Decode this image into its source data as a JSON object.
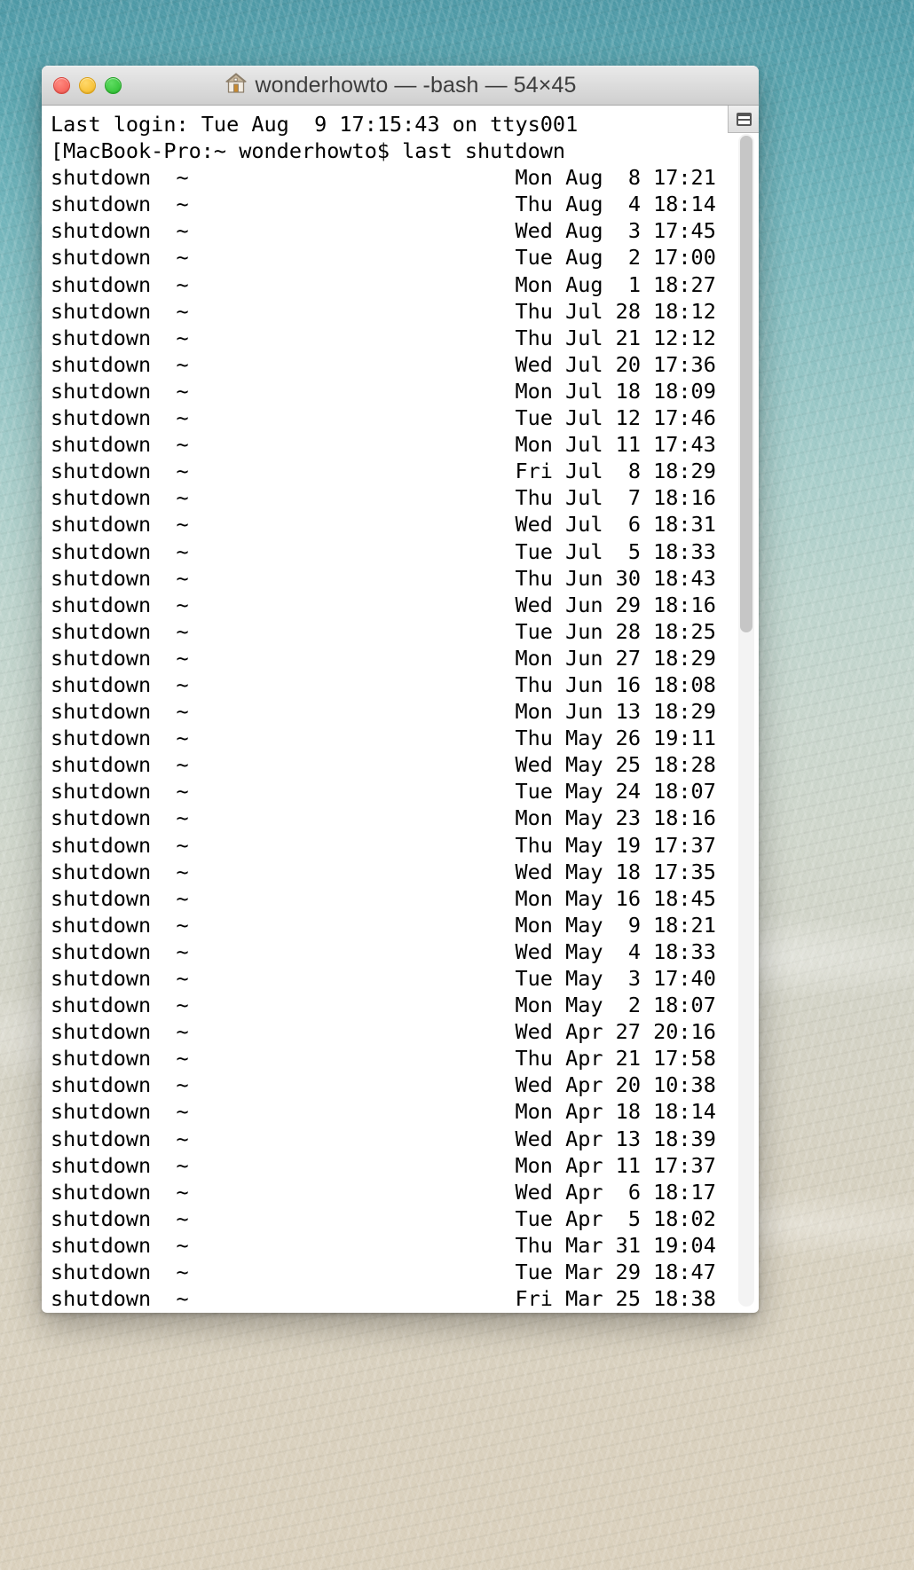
{
  "window": {
    "title": "wonderhowto — -bash — 54×45",
    "title_icon": "house-icon",
    "close_label": "",
    "minimize_label": "",
    "zoom_label": "",
    "split_pane_icon": "split-pane-icon",
    "dimensions_label": "54×45"
  },
  "terminal": {
    "login_line": "Last login: Tue Aug  9 17:15:43 on ttys001",
    "prompt_line": "[MacBook-Pro:~ wonderhowto$ last shutdown",
    "prompt_host": "MacBook-Pro",
    "prompt_cwd": "~",
    "prompt_user": "wonderhowto",
    "command": "last shutdown",
    "col_process": "shutdown",
    "col_tty": "~",
    "entries": [
      {
        "process": "shutdown",
        "tty": "~",
        "day": "Mon",
        "month": "Aug",
        "date": "8",
        "time": "17:21"
      },
      {
        "process": "shutdown",
        "tty": "~",
        "day": "Thu",
        "month": "Aug",
        "date": "4",
        "time": "18:14"
      },
      {
        "process": "shutdown",
        "tty": "~",
        "day": "Wed",
        "month": "Aug",
        "date": "3",
        "time": "17:45"
      },
      {
        "process": "shutdown",
        "tty": "~",
        "day": "Tue",
        "month": "Aug",
        "date": "2",
        "time": "17:00"
      },
      {
        "process": "shutdown",
        "tty": "~",
        "day": "Mon",
        "month": "Aug",
        "date": "1",
        "time": "18:27"
      },
      {
        "process": "shutdown",
        "tty": "~",
        "day": "Thu",
        "month": "Jul",
        "date": "28",
        "time": "18:12"
      },
      {
        "process": "shutdown",
        "tty": "~",
        "day": "Thu",
        "month": "Jul",
        "date": "21",
        "time": "12:12"
      },
      {
        "process": "shutdown",
        "tty": "~",
        "day": "Wed",
        "month": "Jul",
        "date": "20",
        "time": "17:36"
      },
      {
        "process": "shutdown",
        "tty": "~",
        "day": "Mon",
        "month": "Jul",
        "date": "18",
        "time": "18:09"
      },
      {
        "process": "shutdown",
        "tty": "~",
        "day": "Tue",
        "month": "Jul",
        "date": "12",
        "time": "17:46"
      },
      {
        "process": "shutdown",
        "tty": "~",
        "day": "Mon",
        "month": "Jul",
        "date": "11",
        "time": "17:43"
      },
      {
        "process": "shutdown",
        "tty": "~",
        "day": "Fri",
        "month": "Jul",
        "date": "8",
        "time": "18:29"
      },
      {
        "process": "shutdown",
        "tty": "~",
        "day": "Thu",
        "month": "Jul",
        "date": "7",
        "time": "18:16"
      },
      {
        "process": "shutdown",
        "tty": "~",
        "day": "Wed",
        "month": "Jul",
        "date": "6",
        "time": "18:31"
      },
      {
        "process": "shutdown",
        "tty": "~",
        "day": "Tue",
        "month": "Jul",
        "date": "5",
        "time": "18:33"
      },
      {
        "process": "shutdown",
        "tty": "~",
        "day": "Thu",
        "month": "Jun",
        "date": "30",
        "time": "18:43"
      },
      {
        "process": "shutdown",
        "tty": "~",
        "day": "Wed",
        "month": "Jun",
        "date": "29",
        "time": "18:16"
      },
      {
        "process": "shutdown",
        "tty": "~",
        "day": "Tue",
        "month": "Jun",
        "date": "28",
        "time": "18:25"
      },
      {
        "process": "shutdown",
        "tty": "~",
        "day": "Mon",
        "month": "Jun",
        "date": "27",
        "time": "18:29"
      },
      {
        "process": "shutdown",
        "tty": "~",
        "day": "Thu",
        "month": "Jun",
        "date": "16",
        "time": "18:08"
      },
      {
        "process": "shutdown",
        "tty": "~",
        "day": "Mon",
        "month": "Jun",
        "date": "13",
        "time": "18:29"
      },
      {
        "process": "shutdown",
        "tty": "~",
        "day": "Thu",
        "month": "May",
        "date": "26",
        "time": "19:11"
      },
      {
        "process": "shutdown",
        "tty": "~",
        "day": "Wed",
        "month": "May",
        "date": "25",
        "time": "18:28"
      },
      {
        "process": "shutdown",
        "tty": "~",
        "day": "Tue",
        "month": "May",
        "date": "24",
        "time": "18:07"
      },
      {
        "process": "shutdown",
        "tty": "~",
        "day": "Mon",
        "month": "May",
        "date": "23",
        "time": "18:16"
      },
      {
        "process": "shutdown",
        "tty": "~",
        "day": "Thu",
        "month": "May",
        "date": "19",
        "time": "17:37"
      },
      {
        "process": "shutdown",
        "tty": "~",
        "day": "Wed",
        "month": "May",
        "date": "18",
        "time": "17:35"
      },
      {
        "process": "shutdown",
        "tty": "~",
        "day": "Mon",
        "month": "May",
        "date": "16",
        "time": "18:45"
      },
      {
        "process": "shutdown",
        "tty": "~",
        "day": "Mon",
        "month": "May",
        "date": "9",
        "time": "18:21"
      },
      {
        "process": "shutdown",
        "tty": "~",
        "day": "Wed",
        "month": "May",
        "date": "4",
        "time": "18:33"
      },
      {
        "process": "shutdown",
        "tty": "~",
        "day": "Tue",
        "month": "May",
        "date": "3",
        "time": "17:40"
      },
      {
        "process": "shutdown",
        "tty": "~",
        "day": "Mon",
        "month": "May",
        "date": "2",
        "time": "18:07"
      },
      {
        "process": "shutdown",
        "tty": "~",
        "day": "Wed",
        "month": "Apr",
        "date": "27",
        "time": "20:16"
      },
      {
        "process": "shutdown",
        "tty": "~",
        "day": "Thu",
        "month": "Apr",
        "date": "21",
        "time": "17:58"
      },
      {
        "process": "shutdown",
        "tty": "~",
        "day": "Wed",
        "month": "Apr",
        "date": "20",
        "time": "10:38"
      },
      {
        "process": "shutdown",
        "tty": "~",
        "day": "Mon",
        "month": "Apr",
        "date": "18",
        "time": "18:14"
      },
      {
        "process": "shutdown",
        "tty": "~",
        "day": "Wed",
        "month": "Apr",
        "date": "13",
        "time": "18:39"
      },
      {
        "process": "shutdown",
        "tty": "~",
        "day": "Mon",
        "month": "Apr",
        "date": "11",
        "time": "17:37"
      },
      {
        "process": "shutdown",
        "tty": "~",
        "day": "Wed",
        "month": "Apr",
        "date": "6",
        "time": "18:17"
      },
      {
        "process": "shutdown",
        "tty": "~",
        "day": "Tue",
        "month": "Apr",
        "date": "5",
        "time": "18:02"
      },
      {
        "process": "shutdown",
        "tty": "~",
        "day": "Thu",
        "month": "Mar",
        "date": "31",
        "time": "19:04"
      },
      {
        "process": "shutdown",
        "tty": "~",
        "day": "Tue",
        "month": "Mar",
        "date": "29",
        "time": "18:47"
      },
      {
        "process": "shutdown",
        "tty": "~",
        "day": "Fri",
        "month": "Mar",
        "date": "25",
        "time": "18:38"
      }
    ]
  },
  "colors": {
    "terminal_bg": "#ffffff",
    "terminal_fg": "#000000",
    "titlebar_bg": "#dcdcdc",
    "close": "#f2554d",
    "minimize": "#f4b71f",
    "zoom": "#27bb2c",
    "scrollbar_thumb": "#c6c6c6"
  }
}
